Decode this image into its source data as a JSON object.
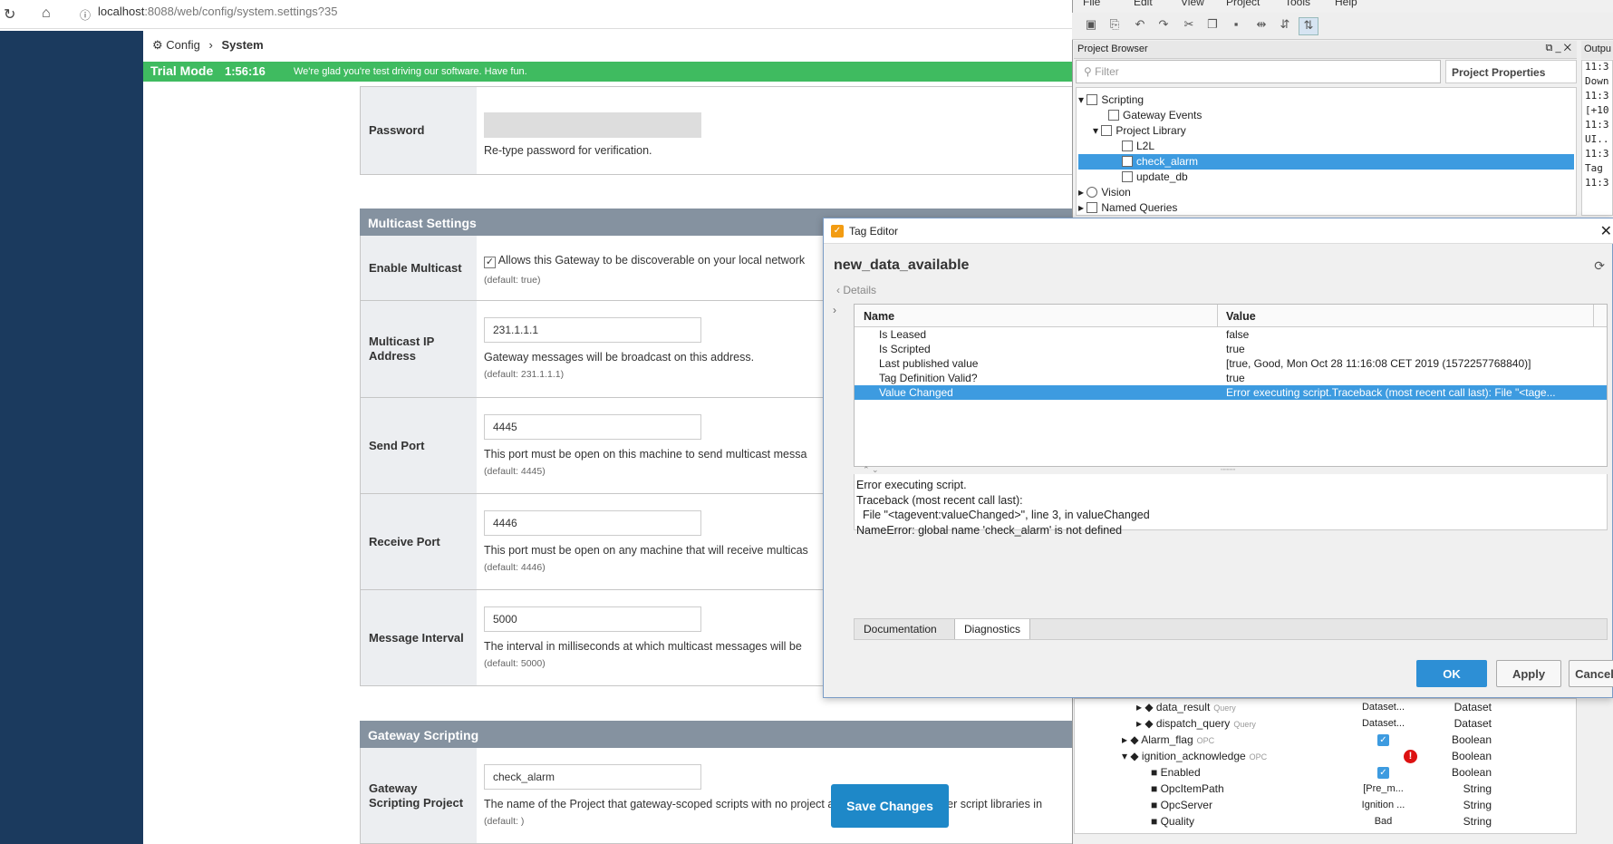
{
  "browser": {
    "url_host": "localhost",
    "url_rest": ":8088/web/config/system.settings?35"
  },
  "breadcrumb": {
    "root": "Config",
    "current": "System"
  },
  "trial": {
    "mode": "Trial Mode",
    "time": "1:56:16",
    "message": "We're glad you're test driving our software. Have fun."
  },
  "password": {
    "label": "Password",
    "desc": "Re-type password for verification."
  },
  "multicast": {
    "header": "Multicast Settings",
    "enable": {
      "label": "Enable Multicast",
      "desc": "Allows this Gateway to be discoverable on your local network",
      "default": "(default: true)"
    },
    "ip": {
      "label": "Multicast IP Address",
      "value": "231.1.1.1",
      "desc": "Gateway messages will be broadcast on this address.",
      "default": "(default: 231.1.1.1)"
    },
    "send": {
      "label": "Send Port",
      "value": "4445",
      "desc": "This port must be open on this machine to send multicast messa",
      "default": "(default: 4445)"
    },
    "receive": {
      "label": "Receive Port",
      "value": "4446",
      "desc": "This port must be open on any machine that will receive multicas",
      "default": "(default: 4446)"
    },
    "interval": {
      "label": "Message Interval",
      "value": "5000",
      "desc": "The interval in milliseconds at which multicast messages will be",
      "default": "(default: 5000)"
    }
  },
  "scripting": {
    "header": "Gateway Scripting",
    "project": {
      "label": "Gateway Scripting Project",
      "value": "check_alarm",
      "desc": "The name of the Project that gateway-scoped scripts with no project affiliation can access user script libraries in",
      "default": "(default: )"
    }
  },
  "save_label": "Save Changes",
  "designer": {
    "menu": [
      "File",
      "Edit",
      "View",
      "Project",
      "Tools",
      "Help"
    ],
    "project_browser": "Project Browser",
    "filter_placeholder": "Filter",
    "project_properties": "Project Properties",
    "tree": {
      "scripting": "Scripting",
      "gateway_events": "Gateway Events",
      "project_library": "Project Library",
      "l2l": "L2L",
      "check_alarm": "check_alarm",
      "update_db": "update_db",
      "vision": "Vision",
      "named_queries": "Named Queries"
    },
    "output_title": "Outpu",
    "output_lines": [
      "11:3",
      "Down",
      "11:3",
      "[+10",
      "11:3",
      "UI..",
      "11:3",
      "Tag",
      "11:3"
    ]
  },
  "tags": [
    {
      "name": "data_result",
      "kind": "Query",
      "value": "Dataset...",
      "type": "Dataset"
    },
    {
      "name": "dispatch_query",
      "kind": "Query",
      "value": "Dataset...",
      "type": "Dataset"
    },
    {
      "name": "Alarm_flag",
      "kind": "OPC",
      "value": "",
      "type": "Boolean"
    },
    {
      "name": "ignition_acknowledge",
      "kind": "OPC",
      "value": "",
      "type": "Boolean"
    },
    {
      "name": "Enabled",
      "kind": "",
      "value": "",
      "type": "Boolean"
    },
    {
      "name": "OpcItemPath",
      "kind": "",
      "value": "[Pre_m...",
      "type": "String"
    },
    {
      "name": "OpcServer",
      "kind": "",
      "value": "Ignition ...",
      "type": "String"
    },
    {
      "name": "Quality",
      "kind": "",
      "value": "Bad",
      "type": "String"
    }
  ],
  "dialog": {
    "title": "Tag Editor",
    "tag_name": "new_data_available",
    "details": "Details",
    "col_name": "Name",
    "col_value": "Value",
    "rows": [
      {
        "name": "Is Leased",
        "value": "false"
      },
      {
        "name": "Is Scripted",
        "value": "true"
      },
      {
        "name": "Last published value",
        "value": "[true, Good, Mon Oct 28 11:16:08 CET 2019 (1572257768840)]"
      },
      {
        "name": "Tag Definition Valid?",
        "value": "true"
      },
      {
        "name": "Value Changed",
        "value": "Error executing script.Traceback (most recent call last):  File \"<tage..."
      }
    ],
    "error_text": "Error executing script.\nTraceback (most recent call last):\n  File \"<tagevent:valueChanged>\", line 3, in valueChanged\nNameError: global name 'check_alarm' is not defined",
    "tab_doc": "Documentation",
    "tab_diag": "Diagnostics",
    "ok": "OK",
    "apply": "Apply",
    "cancel": "Cancel"
  }
}
